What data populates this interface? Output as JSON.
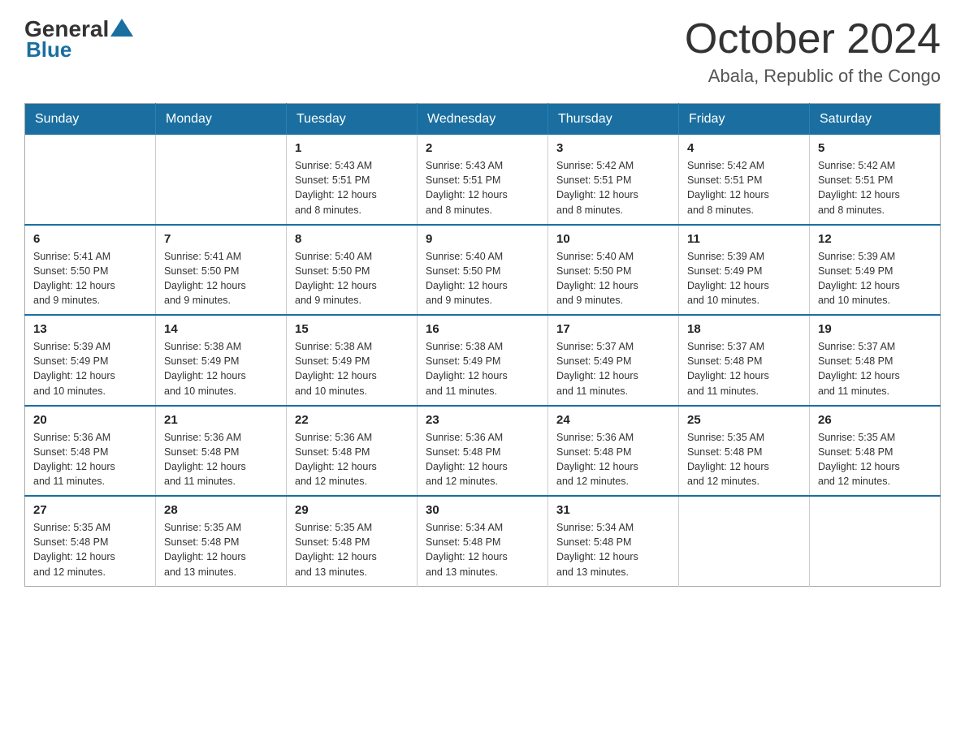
{
  "header": {
    "logo_text_general": "General",
    "logo_text_blue": "Blue",
    "month_title": "October 2024",
    "location": "Abala, Republic of the Congo"
  },
  "calendar": {
    "days_of_week": [
      "Sunday",
      "Monday",
      "Tuesday",
      "Wednesday",
      "Thursday",
      "Friday",
      "Saturday"
    ],
    "weeks": [
      [
        {
          "day": "",
          "info": ""
        },
        {
          "day": "",
          "info": ""
        },
        {
          "day": "1",
          "info": "Sunrise: 5:43 AM\nSunset: 5:51 PM\nDaylight: 12 hours\nand 8 minutes."
        },
        {
          "day": "2",
          "info": "Sunrise: 5:43 AM\nSunset: 5:51 PM\nDaylight: 12 hours\nand 8 minutes."
        },
        {
          "day": "3",
          "info": "Sunrise: 5:42 AM\nSunset: 5:51 PM\nDaylight: 12 hours\nand 8 minutes."
        },
        {
          "day": "4",
          "info": "Sunrise: 5:42 AM\nSunset: 5:51 PM\nDaylight: 12 hours\nand 8 minutes."
        },
        {
          "day": "5",
          "info": "Sunrise: 5:42 AM\nSunset: 5:51 PM\nDaylight: 12 hours\nand 8 minutes."
        }
      ],
      [
        {
          "day": "6",
          "info": "Sunrise: 5:41 AM\nSunset: 5:50 PM\nDaylight: 12 hours\nand 9 minutes."
        },
        {
          "day": "7",
          "info": "Sunrise: 5:41 AM\nSunset: 5:50 PM\nDaylight: 12 hours\nand 9 minutes."
        },
        {
          "day": "8",
          "info": "Sunrise: 5:40 AM\nSunset: 5:50 PM\nDaylight: 12 hours\nand 9 minutes."
        },
        {
          "day": "9",
          "info": "Sunrise: 5:40 AM\nSunset: 5:50 PM\nDaylight: 12 hours\nand 9 minutes."
        },
        {
          "day": "10",
          "info": "Sunrise: 5:40 AM\nSunset: 5:50 PM\nDaylight: 12 hours\nand 9 minutes."
        },
        {
          "day": "11",
          "info": "Sunrise: 5:39 AM\nSunset: 5:49 PM\nDaylight: 12 hours\nand 10 minutes."
        },
        {
          "day": "12",
          "info": "Sunrise: 5:39 AM\nSunset: 5:49 PM\nDaylight: 12 hours\nand 10 minutes."
        }
      ],
      [
        {
          "day": "13",
          "info": "Sunrise: 5:39 AM\nSunset: 5:49 PM\nDaylight: 12 hours\nand 10 minutes."
        },
        {
          "day": "14",
          "info": "Sunrise: 5:38 AM\nSunset: 5:49 PM\nDaylight: 12 hours\nand 10 minutes."
        },
        {
          "day": "15",
          "info": "Sunrise: 5:38 AM\nSunset: 5:49 PM\nDaylight: 12 hours\nand 10 minutes."
        },
        {
          "day": "16",
          "info": "Sunrise: 5:38 AM\nSunset: 5:49 PM\nDaylight: 12 hours\nand 11 minutes."
        },
        {
          "day": "17",
          "info": "Sunrise: 5:37 AM\nSunset: 5:49 PM\nDaylight: 12 hours\nand 11 minutes."
        },
        {
          "day": "18",
          "info": "Sunrise: 5:37 AM\nSunset: 5:48 PM\nDaylight: 12 hours\nand 11 minutes."
        },
        {
          "day": "19",
          "info": "Sunrise: 5:37 AM\nSunset: 5:48 PM\nDaylight: 12 hours\nand 11 minutes."
        }
      ],
      [
        {
          "day": "20",
          "info": "Sunrise: 5:36 AM\nSunset: 5:48 PM\nDaylight: 12 hours\nand 11 minutes."
        },
        {
          "day": "21",
          "info": "Sunrise: 5:36 AM\nSunset: 5:48 PM\nDaylight: 12 hours\nand 11 minutes."
        },
        {
          "day": "22",
          "info": "Sunrise: 5:36 AM\nSunset: 5:48 PM\nDaylight: 12 hours\nand 12 minutes."
        },
        {
          "day": "23",
          "info": "Sunrise: 5:36 AM\nSunset: 5:48 PM\nDaylight: 12 hours\nand 12 minutes."
        },
        {
          "day": "24",
          "info": "Sunrise: 5:36 AM\nSunset: 5:48 PM\nDaylight: 12 hours\nand 12 minutes."
        },
        {
          "day": "25",
          "info": "Sunrise: 5:35 AM\nSunset: 5:48 PM\nDaylight: 12 hours\nand 12 minutes."
        },
        {
          "day": "26",
          "info": "Sunrise: 5:35 AM\nSunset: 5:48 PM\nDaylight: 12 hours\nand 12 minutes."
        }
      ],
      [
        {
          "day": "27",
          "info": "Sunrise: 5:35 AM\nSunset: 5:48 PM\nDaylight: 12 hours\nand 12 minutes."
        },
        {
          "day": "28",
          "info": "Sunrise: 5:35 AM\nSunset: 5:48 PM\nDaylight: 12 hours\nand 13 minutes."
        },
        {
          "day": "29",
          "info": "Sunrise: 5:35 AM\nSunset: 5:48 PM\nDaylight: 12 hours\nand 13 minutes."
        },
        {
          "day": "30",
          "info": "Sunrise: 5:34 AM\nSunset: 5:48 PM\nDaylight: 12 hours\nand 13 minutes."
        },
        {
          "day": "31",
          "info": "Sunrise: 5:34 AM\nSunset: 5:48 PM\nDaylight: 12 hours\nand 13 minutes."
        },
        {
          "day": "",
          "info": ""
        },
        {
          "day": "",
          "info": ""
        }
      ]
    ]
  }
}
